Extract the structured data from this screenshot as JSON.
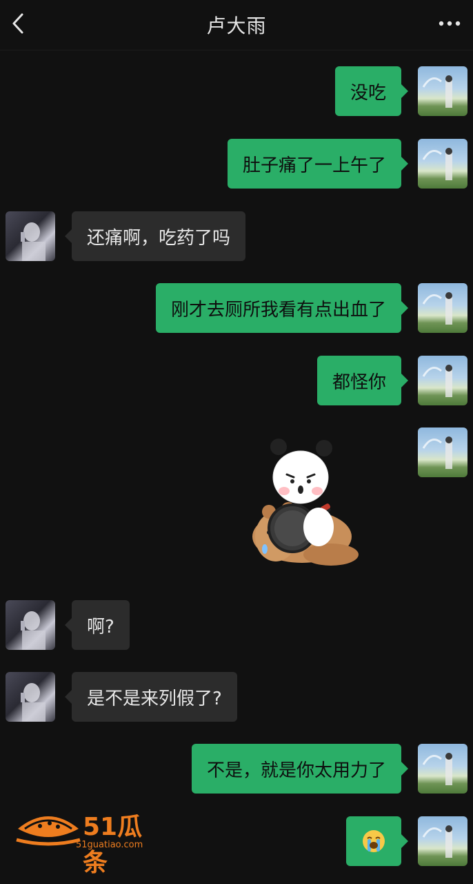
{
  "header": {
    "title": "卢大雨",
    "back_icon": "chevron-left-icon",
    "more_icon": "more-dots-icon"
  },
  "messages": [
    {
      "sender": "me",
      "text": "没吃"
    },
    {
      "sender": "me",
      "text": "肚子痛了一上午了"
    },
    {
      "sender": "other",
      "text": "还痛啊，吃药了吗"
    },
    {
      "sender": "me",
      "text": "刚才去厕所我看有点出血了"
    },
    {
      "sender": "me",
      "text": "都怪你"
    },
    {
      "sender": "me",
      "sticker": "panda-hitting-bear-with-pan"
    },
    {
      "sender": "other",
      "text": "啊?"
    },
    {
      "sender": "other",
      "text": "是不是来列假了?"
    },
    {
      "sender": "me",
      "text": "不是，就是你太用力了"
    },
    {
      "sender": "me",
      "emoji": "😭"
    }
  ],
  "watermark": {
    "brand": "51瓜条",
    "url": "51guatiao.com"
  },
  "colors": {
    "background": "#111111",
    "my_bubble": "#2aae67",
    "other_bubble": "#2c2c2c",
    "watermark": "#ee7d1f"
  }
}
